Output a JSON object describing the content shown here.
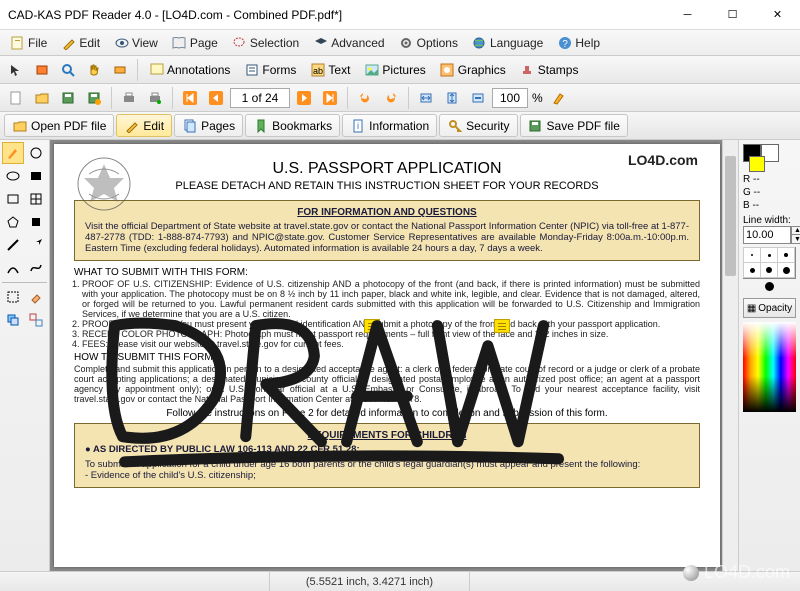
{
  "window": {
    "title": "CAD-KAS PDF Reader 4.0 - [LO4D.com - Combined PDF.pdf*]"
  },
  "menu": {
    "file": "File",
    "edit": "Edit",
    "view": "View",
    "page": "Page",
    "selection": "Selection",
    "advanced": "Advanced",
    "options": "Options",
    "language": "Language",
    "help": "Help"
  },
  "toolbar2": {
    "annotations": "Annotations",
    "forms": "Forms",
    "text": "Text",
    "pictures": "Pictures",
    "graphics": "Graphics",
    "stamps": "Stamps"
  },
  "nav": {
    "page_display": "1 of 24",
    "zoom_value": "100",
    "zoom_suffix": "%"
  },
  "tabs": {
    "open": "Open PDF file",
    "edit": "Edit",
    "pages": "Pages",
    "bookmarks": "Bookmarks",
    "information": "Information",
    "security": "Security",
    "save": "Save PDF file"
  },
  "rightpanel": {
    "r_label": "R --",
    "g_label": "G --",
    "b_label": "B --",
    "line_width_label": "Line width:",
    "line_width_value": "10.00",
    "opacity_label": "Opacity"
  },
  "status": {
    "coords": "(5.5521 inch, 3.4271 inch)"
  },
  "doc": {
    "watermark": "LO4D.com",
    "title": "U.S. PASSPORT APPLICATION",
    "subtitle": "PLEASE DETACH AND RETAIN THIS INSTRUCTION SHEET FOR YOUR RECORDS",
    "box1_title": "FOR INFORMATION AND QUESTIONS",
    "box1_body": "Visit the official Department of State website at travel.state.gov or contact the National Passport Information Center (NPIC) via toll-free at 1-877-487-2778 (TDD: 1-888-874-7793) and NPIC@state.gov. Customer Service Representatives are available Monday-Friday 8:00a.m.-10:00p.m. Eastern Time (excluding federal holidays). Automated information is available 24 hours a day, 7 days a week.",
    "what_to_submit": "WHAT TO SUBMIT WITH THIS FORM:",
    "ol1": "PROOF OF U.S. CITIZENSHIP: Evidence of U.S. citizenship AND a photocopy of the front (and back, if there is printed information) must be submitted with your application. The photocopy must be on 8 ½ inch by 11 inch paper, black and white ink, legible, and clear. Evidence that is not damaged, altered, or forged will be returned to you. Lawful permanent resident cards submitted with this application will be forwarded to U.S. Citizenship and Immigration Services, if we determine that you are a U.S. citizen.",
    "ol2": "PROOF OF IDENTITY: You must present your original identification AND submit a photocopy of the front and back with your passport application.",
    "ol3": "RECENT COLOR PHOTOGRAPH: Photograph must meet passport requirements – full front view of the face and 2x2 inches in size.",
    "ol4": "FEES: Please visit our website at travel.state.gov for current fees.",
    "how_to_submit": "HOW TO SUBMIT THIS FORM:",
    "how_body": "Complete and submit this application in person to a designated acceptance agent: a clerk of a federal or state court of record or a judge or clerk of a probate court accepting applications; a designated municipal or county official; a designated postal employee at an authorized post office; an agent at a passport agency (by appointment only); or a U.S. consular official at a U.S. Embassy or Consulate, if abroad. To find your nearest acceptance facility, visit travel.state.gov or contact the National Passport Information Center at 1-877-487-2778.",
    "follow": "Follow the instructions on Page 2 for detailed information to completion and submission of this form.",
    "box2_title": "REQUIREMENTS FOR CHILDREN",
    "box2_bullet": "● AS DIRECTED BY PUBLIC LAW 106-113 AND 22 CFR 51.28:",
    "box2_body": "To submit an application for a child under age 16 both parents or the child's legal guardian(s) must appear and present the following:\n- Evidence of the child's U.S. citizenship;"
  },
  "annotation": {
    "draw_text": "DRAW"
  },
  "footer_brand": "LO4D.com"
}
